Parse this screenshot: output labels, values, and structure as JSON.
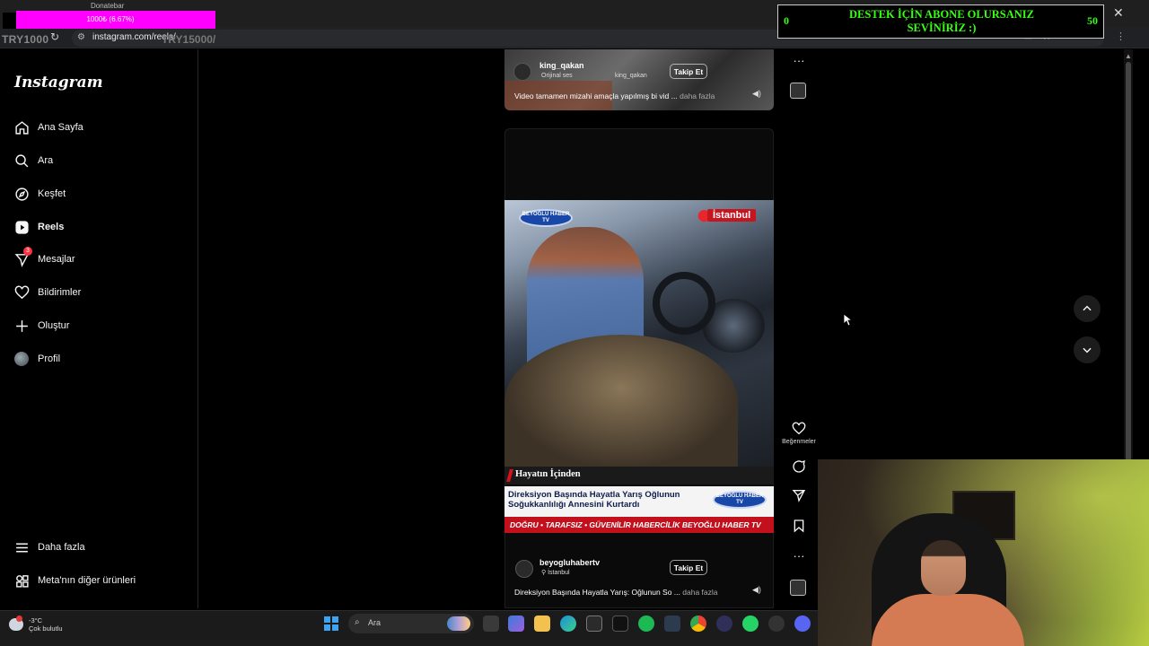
{
  "browser": {
    "url": "instagram.com/reels/",
    "url_overlay": "TRY15000/"
  },
  "overlay": {
    "donatebar_label": "Donatebar",
    "donate_progress_text": "1000₺ (6.67%)",
    "try_left": "TRY1000",
    "goal_left": "0",
    "goal_right": "50",
    "goal_message": "DESTEK İÇİN ABONE OLURSANIZ SEVİNİRİZ :)",
    "colors": {
      "goal_text": "#39ff14",
      "donate_bar": "#ff00ff"
    }
  },
  "sidebar": {
    "logo": "Instagram",
    "items": [
      {
        "label": "Ana Sayfa",
        "icon": "home-icon"
      },
      {
        "label": "Ara",
        "icon": "search-icon"
      },
      {
        "label": "Keşfet",
        "icon": "compass-icon"
      },
      {
        "label": "Reels",
        "icon": "reels-icon",
        "active": true
      },
      {
        "label": "Mesajlar",
        "icon": "messenger-icon",
        "badge": "3"
      },
      {
        "label": "Bildirimler",
        "icon": "heart-icon"
      },
      {
        "label": "Oluştur",
        "icon": "plus-icon"
      },
      {
        "label": "Profil",
        "icon": "avatar"
      }
    ],
    "bottom": [
      {
        "label": "Daha fazla",
        "icon": "menu-icon"
      },
      {
        "label": "Meta'nın diğer ürünleri",
        "icon": "grid-icon"
      }
    ]
  },
  "reel_previous": {
    "username": "king_qakan",
    "audio": "Orijinal ses",
    "audio_user": "king_qakan",
    "follow_label": "Takip Et",
    "caption": "Video tamamen mizahi amaçla yapılmış bi vid ...",
    "more": "daha fazla"
  },
  "reel_current": {
    "location_tag": "İstanbul",
    "channel_logo": "BEYOĞLU HABER TV",
    "lower_title": "Hayatın İçinden",
    "headline": "Direksiyon Başında Hayatla Yarış Oğlunun Soğukkanlılığı Annesini Kurtardı",
    "ticker": "DOĞRU • TARAFSIZ • GÜVENİLİR HABERCİLİK BEYOĞLU HABER TV",
    "username": "beyogluhabertv",
    "location": "İstanbul",
    "follow_label": "Takip Et",
    "caption": "Direksiyon Başında Hayatla Yarış: Oğlunun So ...",
    "more": "daha fazla"
  },
  "actions": {
    "like_label": "Beğenmeler"
  },
  "taskbar": {
    "temperature": "-3°C",
    "weather": "Çok bulutlu",
    "search_placeholder": "Ara"
  }
}
